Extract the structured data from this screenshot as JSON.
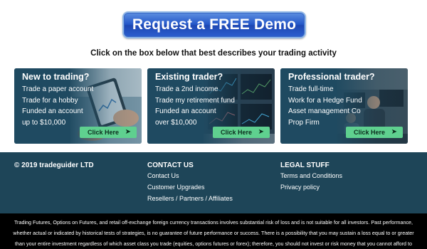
{
  "header": {
    "demo_button_label": "Request a FREE Demo",
    "subheading": "Click on the box below that best describes your trading activity"
  },
  "cards": [
    {
      "title": "New to trading?",
      "items": [
        "Trade a paper account",
        "Trade for a hobby",
        "Funded an account",
        "up to $10,000"
      ],
      "cta": "Click Here"
    },
    {
      "title": "Existing trader?",
      "items": [
        "Trade a 2nd income",
        "Trade my retirement fund",
        "Funded an account",
        "over $10,000"
      ],
      "cta": "Click Here"
    },
    {
      "title": "Professional trader?",
      "items": [
        "Trade full-time",
        "Work for a Hedge Fund",
        "Asset management Co",
        "Prop Firm"
      ],
      "cta": "Click Here"
    }
  ],
  "footer": {
    "copyright": "© 2019 tradeguider LTD",
    "contact": {
      "heading": "CONTACT US",
      "links": [
        "Contact Us",
        "Customer Upgrades",
        "Resellers / Partners / Affiliates"
      ]
    },
    "legal": {
      "heading": "LEGAL STUFF",
      "links": [
        "Terms and Conditions",
        "Privacy policy"
      ]
    }
  },
  "disclaimer": "Trading Futures, Options on Futures, and retail off-exchange foreign currency transactions involves substantial risk of loss and is not suitable for all investors. Past performance, whether actual or indicated by historical tests of strategies, is no guarantee of future performance or success. There is a possibility that you may sustain a loss equal to or greater than your entire investment regardless of which asset class you trade (equities, options futures or forex); therefore, you should not invest or risk money that you cannot afford to lose.",
  "colors": {
    "footer_bg": "#1e4558",
    "card_bg": "#1f4a61",
    "cta_green": "#5fd08f",
    "demo_blue": "#2457c9"
  }
}
